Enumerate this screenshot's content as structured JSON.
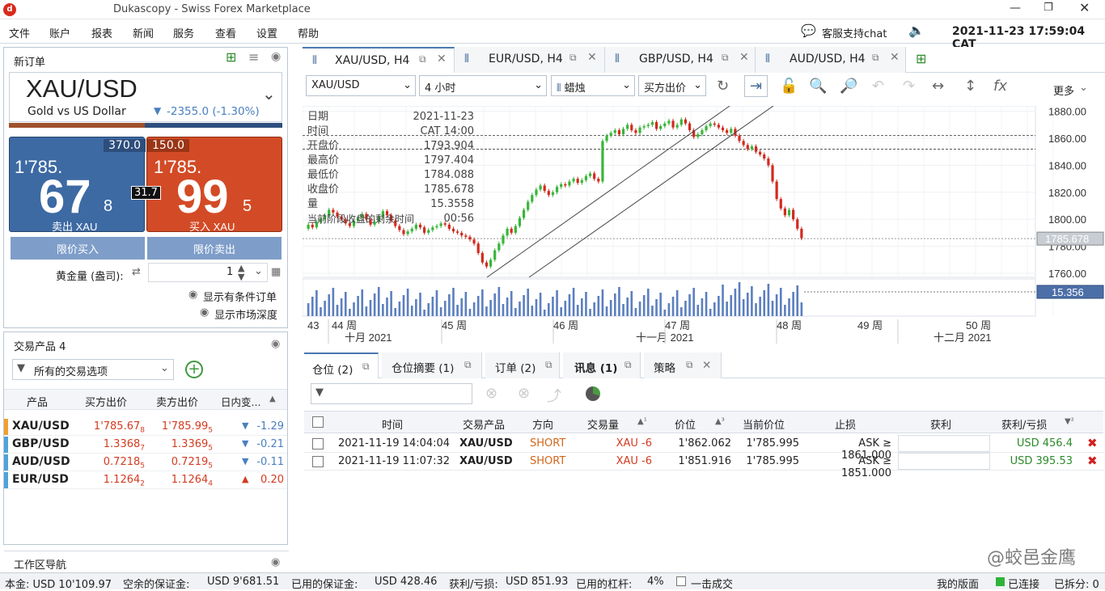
{
  "window": {
    "title": "Dukascopy - Swiss Forex Marketplace",
    "datetime": "2021-11-23 17:59:04 CAT",
    "support": "客服支持chat"
  },
  "menu": [
    "文件",
    "账户",
    "报表",
    "新闻",
    "服务",
    "查看",
    "设置",
    "帮助"
  ],
  "order": {
    "panel_title": "新订单",
    "symbol": "XAU/USD",
    "desc": "Gold vs US Dollar",
    "change": "-2355.0 (-1.30%)",
    "sell": {
      "vol": "370.0",
      "pre": "1'785.",
      "big": "67",
      "small": "8",
      "label": "卖出 XAU"
    },
    "buy": {
      "vol": "150.0",
      "pre": "1'785.",
      "big": "99",
      "small": "5",
      "label": "买入 XAU"
    },
    "spread": "31.7",
    "limit_buy": "限价买入",
    "limit_sell": "限价卖出",
    "amount_label": "黄金量 (盎司):",
    "amount": "1",
    "show_conditional": "显示有条件订单",
    "show_depth": "显示市场深度"
  },
  "instruments": {
    "title": "交易产品 4",
    "filter": "所有的交易选项",
    "columns": [
      "产品",
      "买方出价",
      "卖方出价",
      "日内变..."
    ],
    "rows": [
      {
        "sym": "XAU/USD",
        "bid": "1'785.67",
        "bid_s": "8",
        "ask": "1'785.99",
        "ask_s": "5",
        "chg": "-1.29",
        "dir": "down",
        "color": "#f0a030"
      },
      {
        "sym": "GBP/USD",
        "bid": "1.3368",
        "bid_s": "7",
        "ask": "1.3369",
        "ask_s": "5",
        "chg": "-0.21",
        "dir": "down",
        "color": "#4fa3d8"
      },
      {
        "sym": "AUD/USD",
        "bid": "0.7218",
        "bid_s": "5",
        "ask": "0.7219",
        "ask_s": "5",
        "chg": "-0.11",
        "dir": "down",
        "color": "#4fa3d8"
      },
      {
        "sym": "EUR/USD",
        "bid": "1.1264",
        "bid_s": "2",
        "ask": "1.1264",
        "ask_s": "4",
        "chg": "0.20",
        "dir": "up",
        "color": "#4fa3d8"
      }
    ]
  },
  "workspace": "工作区导航",
  "chart_tabs": [
    "XAU/USD, H4",
    "EUR/USD, H4",
    "GBP/USD, H4",
    "AUD/USD, H4"
  ],
  "toolbar": {
    "symbol": "XAU/USD",
    "period": "4 小时",
    "type": "蜡烛",
    "side": "买方出价",
    "more": "更多"
  },
  "ohlc": [
    [
      "日期",
      "2021-11-23"
    ],
    [
      "时间",
      "CAT 14:00"
    ],
    [
      "开盘价",
      "1793.904"
    ],
    [
      "最高价",
      "1797.404"
    ],
    [
      "最低价",
      "1784.088"
    ],
    [
      "收盘价",
      "1785.678"
    ],
    [
      "量",
      "15.3558"
    ],
    [
      "当前阶段收盘的剩余时间",
      "00:56"
    ]
  ],
  "chart_data": {
    "type": "candlestick",
    "y_ticks": [
      "1880.00",
      "1860.00",
      "1840.00",
      "1820.00",
      "1800.00",
      "1780.00",
      "1760.00"
    ],
    "ylim": [
      1757,
      1884
    ],
    "current_price": "1785.678",
    "volume_label": "15.356",
    "x_ticks": [
      "43",
      "44 周",
      "45 周",
      "46 周",
      "47 周",
      "48 周",
      "49 周",
      "50 周"
    ],
    "months": [
      "十月 2021",
      "十一月 2021",
      "十二月 2021"
    ],
    "close_path": [
      1793,
      1796,
      1794,
      1798,
      1800,
      1803,
      1807,
      1805,
      1802,
      1800,
      1797,
      1795,
      1799,
      1801,
      1804,
      1800,
      1796,
      1798,
      1802,
      1806,
      1803,
      1799,
      1795,
      1792,
      1789,
      1791,
      1793,
      1796,
      1794,
      1790,
      1792,
      1794,
      1795,
      1797,
      1796,
      1793,
      1791,
      1790,
      1788,
      1787,
      1785,
      1782,
      1775,
      1768,
      1765,
      1770,
      1777,
      1782,
      1788,
      1793,
      1790,
      1795,
      1801,
      1807,
      1813,
      1818,
      1822,
      1825,
      1821,
      1818,
      1820,
      1824,
      1826,
      1825,
      1828,
      1830,
      1827,
      1829,
      1832,
      1834,
      1830,
      1828,
      1858,
      1862,
      1864,
      1866,
      1863,
      1867,
      1870,
      1866,
      1864,
      1868,
      1869,
      1870,
      1872,
      1867,
      1869,
      1871,
      1873,
      1868,
      1870,
      1874,
      1871,
      1866,
      1861,
      1863,
      1866,
      1869,
      1871,
      1870,
      1868,
      1866,
      1864,
      1867,
      1862,
      1858,
      1855,
      1852,
      1854,
      1850,
      1848,
      1845,
      1840,
      1828,
      1815,
      1808,
      1803,
      1807,
      1800,
      1793,
      1786
    ]
  },
  "bottom_tabs": [
    "仓位 (2)",
    "仓位摘要 (1)",
    "订单 (2)",
    "讯息 (1)",
    "策略"
  ],
  "positions": {
    "columns": [
      "时间",
      "交易产品",
      "方向",
      "交易量",
      "价位",
      "当前价位",
      "止损",
      "获利",
      "获利/亏损"
    ],
    "rows": [
      [
        "2021-11-19 14:04:04",
        "XAU/USD",
        "SHORT",
        "XAU -6",
        "1'862.062",
        "1'785.995",
        "ASK ≥ 1861.000",
        "",
        "USD 456.4"
      ],
      [
        "2021-11-19 11:07:32",
        "XAU/USD",
        "SHORT",
        "XAU -6",
        "1'851.916",
        "1'785.995",
        "ASK ≥ 1851.000",
        "",
        "USD 395.53"
      ]
    ]
  },
  "status": {
    "equity": "本金: USD 10'109.97",
    "free": "空余的保证金:",
    "free_v": "USD 9'681.51",
    "used": "已用的保证金:",
    "used_v": "USD 428.46",
    "pl": "获利/亏损:",
    "pl_v": "USD 851.93",
    "lev": "已用的杠杆:",
    "lev_v": "4%",
    "oneclick": "一击成交",
    "layout": "我的版面",
    "conn": "已连接",
    "split": "已拆分: 0"
  },
  "watermark": "@蛟邑金鹰"
}
